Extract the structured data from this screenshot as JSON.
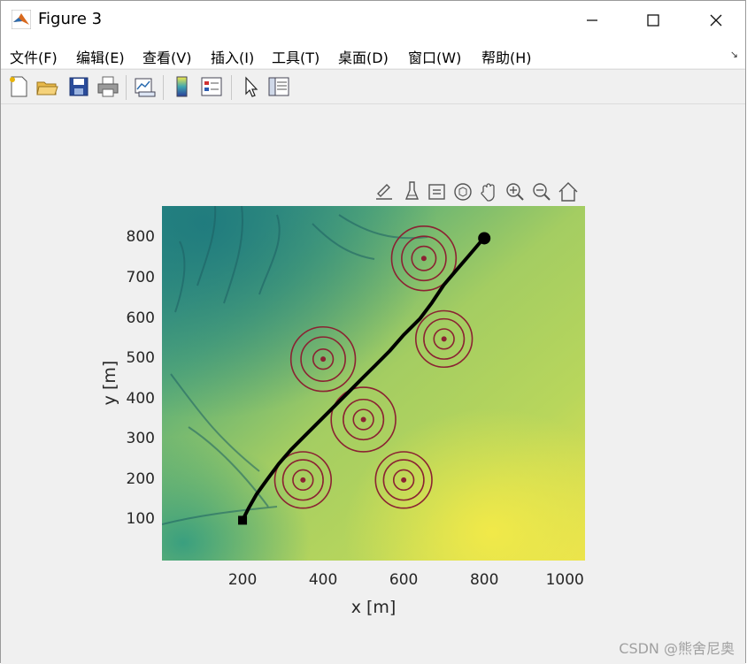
{
  "window": {
    "title": "Figure 3"
  },
  "menu": [
    "文件(F)",
    "编辑(E)",
    "查看(V)",
    "插入(I)",
    "工具(T)",
    "桌面(D)",
    "窗口(W)",
    "帮助(H)"
  ],
  "toolbar_icons": [
    "new-figure-icon",
    "open-file-icon",
    "save-icon",
    "print-icon",
    "link-plot-icon",
    "colorbar-icon",
    "legend-icon",
    "edit-plot-icon",
    "property-inspector-icon"
  ],
  "axes_toolbar_icons": [
    "export-icon",
    "brush-icon",
    "data-tips-icon",
    "rotate-3d-icon",
    "pan-icon",
    "zoom-in-icon",
    "zoom-out-icon",
    "restore-view-icon"
  ],
  "chart_data": {
    "type": "line",
    "xlabel": "x [m]",
    "ylabel": "y [m]",
    "xlim": [
      0,
      1050
    ],
    "ylim": [
      0,
      880
    ],
    "xticks": [
      200,
      400,
      600,
      800,
      1000
    ],
    "yticks": [
      100,
      200,
      300,
      400,
      500,
      600,
      700,
      800
    ],
    "path": {
      "x": [
        200,
        215,
        235,
        260,
        290,
        320,
        355,
        390,
        425,
        460,
        495,
        530,
        565,
        600,
        640,
        670,
        700,
        730,
        760,
        790,
        800
      ],
      "y": [
        100,
        130,
        165,
        200,
        240,
        275,
        310,
        345,
        380,
        415,
        450,
        485,
        520,
        560,
        600,
        640,
        685,
        720,
        755,
        790,
        800
      ],
      "start_marker": "square",
      "end_marker": "circle"
    },
    "threats": [
      {
        "x": 350,
        "y": 200,
        "radii": [
          25,
          50,
          70
        ]
      },
      {
        "x": 600,
        "y": 200,
        "radii": [
          25,
          50,
          70
        ]
      },
      {
        "x": 500,
        "y": 350,
        "radii": [
          25,
          50,
          80
        ]
      },
      {
        "x": 400,
        "y": 500,
        "radii": [
          25,
          55,
          80
        ]
      },
      {
        "x": 700,
        "y": 550,
        "radii": [
          25,
          50,
          70
        ]
      },
      {
        "x": 650,
        "y": 750,
        "radii": [
          30,
          55,
          80
        ]
      }
    ],
    "colors": {
      "path": "#000000",
      "threat": "#8b2232",
      "terrain_low": "#2a8f8a",
      "terrain_mid": "#9acb64",
      "terrain_high": "#f2e84a"
    }
  },
  "watermark": "CSDN @熊舍尼奥"
}
